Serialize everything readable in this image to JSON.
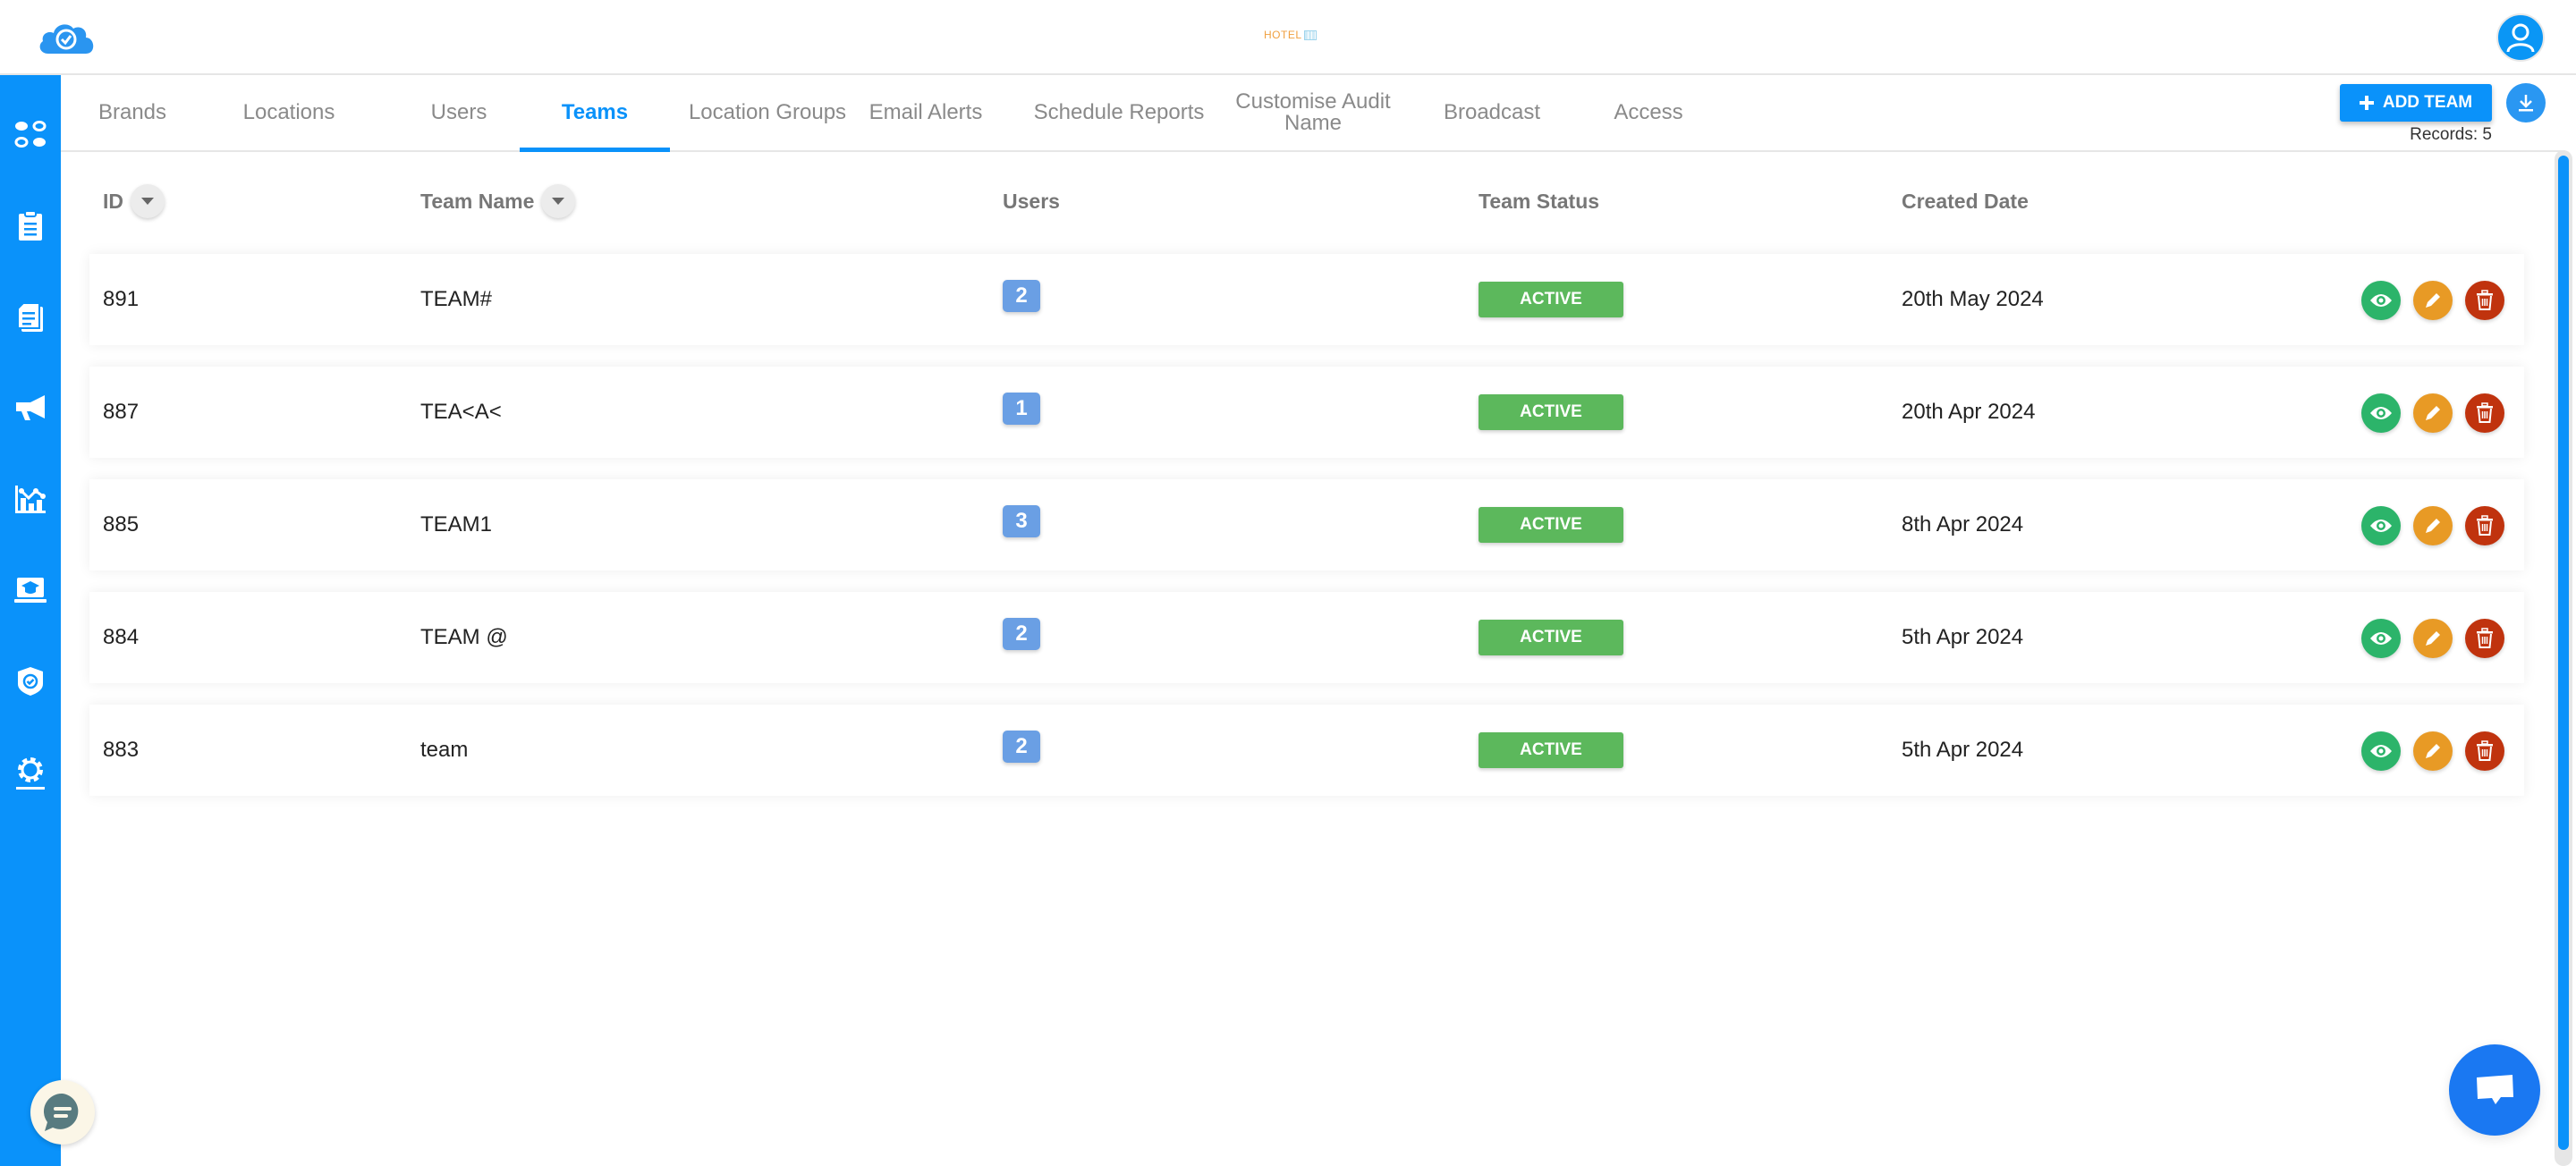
{
  "header": {
    "logo_icon": "cloud-check-icon",
    "brand_text": "HOTEL",
    "user_icon": "user-icon"
  },
  "sidebar": {
    "items": [
      {
        "name": "dashboard",
        "icon": "dots-grid-icon"
      },
      {
        "name": "audits",
        "icon": "clipboard-icon"
      },
      {
        "name": "documents",
        "icon": "documents-icon"
      },
      {
        "name": "broadcast",
        "icon": "megaphone-icon"
      },
      {
        "name": "analytics",
        "icon": "chart-icon"
      },
      {
        "name": "training",
        "icon": "laptop-graduation-icon"
      },
      {
        "name": "compliance",
        "icon": "shield-check-icon"
      },
      {
        "name": "settings",
        "icon": "gear-icon"
      }
    ]
  },
  "tabs": [
    {
      "label": "Brands",
      "active": false
    },
    {
      "label": "Locations",
      "active": false
    },
    {
      "label": "Users",
      "active": false
    },
    {
      "label": "Teams",
      "active": true
    },
    {
      "label": "Location Groups",
      "active": false
    },
    {
      "label": "Email Alerts",
      "active": false
    },
    {
      "label": "Schedule Reports",
      "active": false
    },
    {
      "label": "Customise Audit Name",
      "active": false
    },
    {
      "label": "Broadcast",
      "active": false
    },
    {
      "label": "Access",
      "active": false
    }
  ],
  "toolbar": {
    "add_label": "ADD TEAM",
    "records_text": "Records: 5"
  },
  "table": {
    "columns": [
      "ID",
      "Team Name",
      "Users",
      "Team Status",
      "Created Date"
    ],
    "rows": [
      {
        "id": "891",
        "name": "TEAM#",
        "users": "2",
        "status": "ACTIVE",
        "created": "20th May 2024"
      },
      {
        "id": "887",
        "name": "TEA<A<",
        "users": "1",
        "status": "ACTIVE",
        "created": "20th Apr 2024"
      },
      {
        "id": "885",
        "name": "TEAM1",
        "users": "3",
        "status": "ACTIVE",
        "created": "8th Apr 2024"
      },
      {
        "id": "884",
        "name": "TEAM @",
        "users": "2",
        "status": "ACTIVE",
        "created": "5th Apr 2024"
      },
      {
        "id": "883",
        "name": "team",
        "users": "2",
        "status": "ACTIVE",
        "created": "5th Apr 2024"
      }
    ]
  },
  "colors": {
    "primary": "#0a92fa",
    "status_active": "#5cb85c",
    "users_badge": "#6a9fe4",
    "view": "#2cb46a",
    "edit": "#e89a25",
    "delete": "#c0330e"
  }
}
